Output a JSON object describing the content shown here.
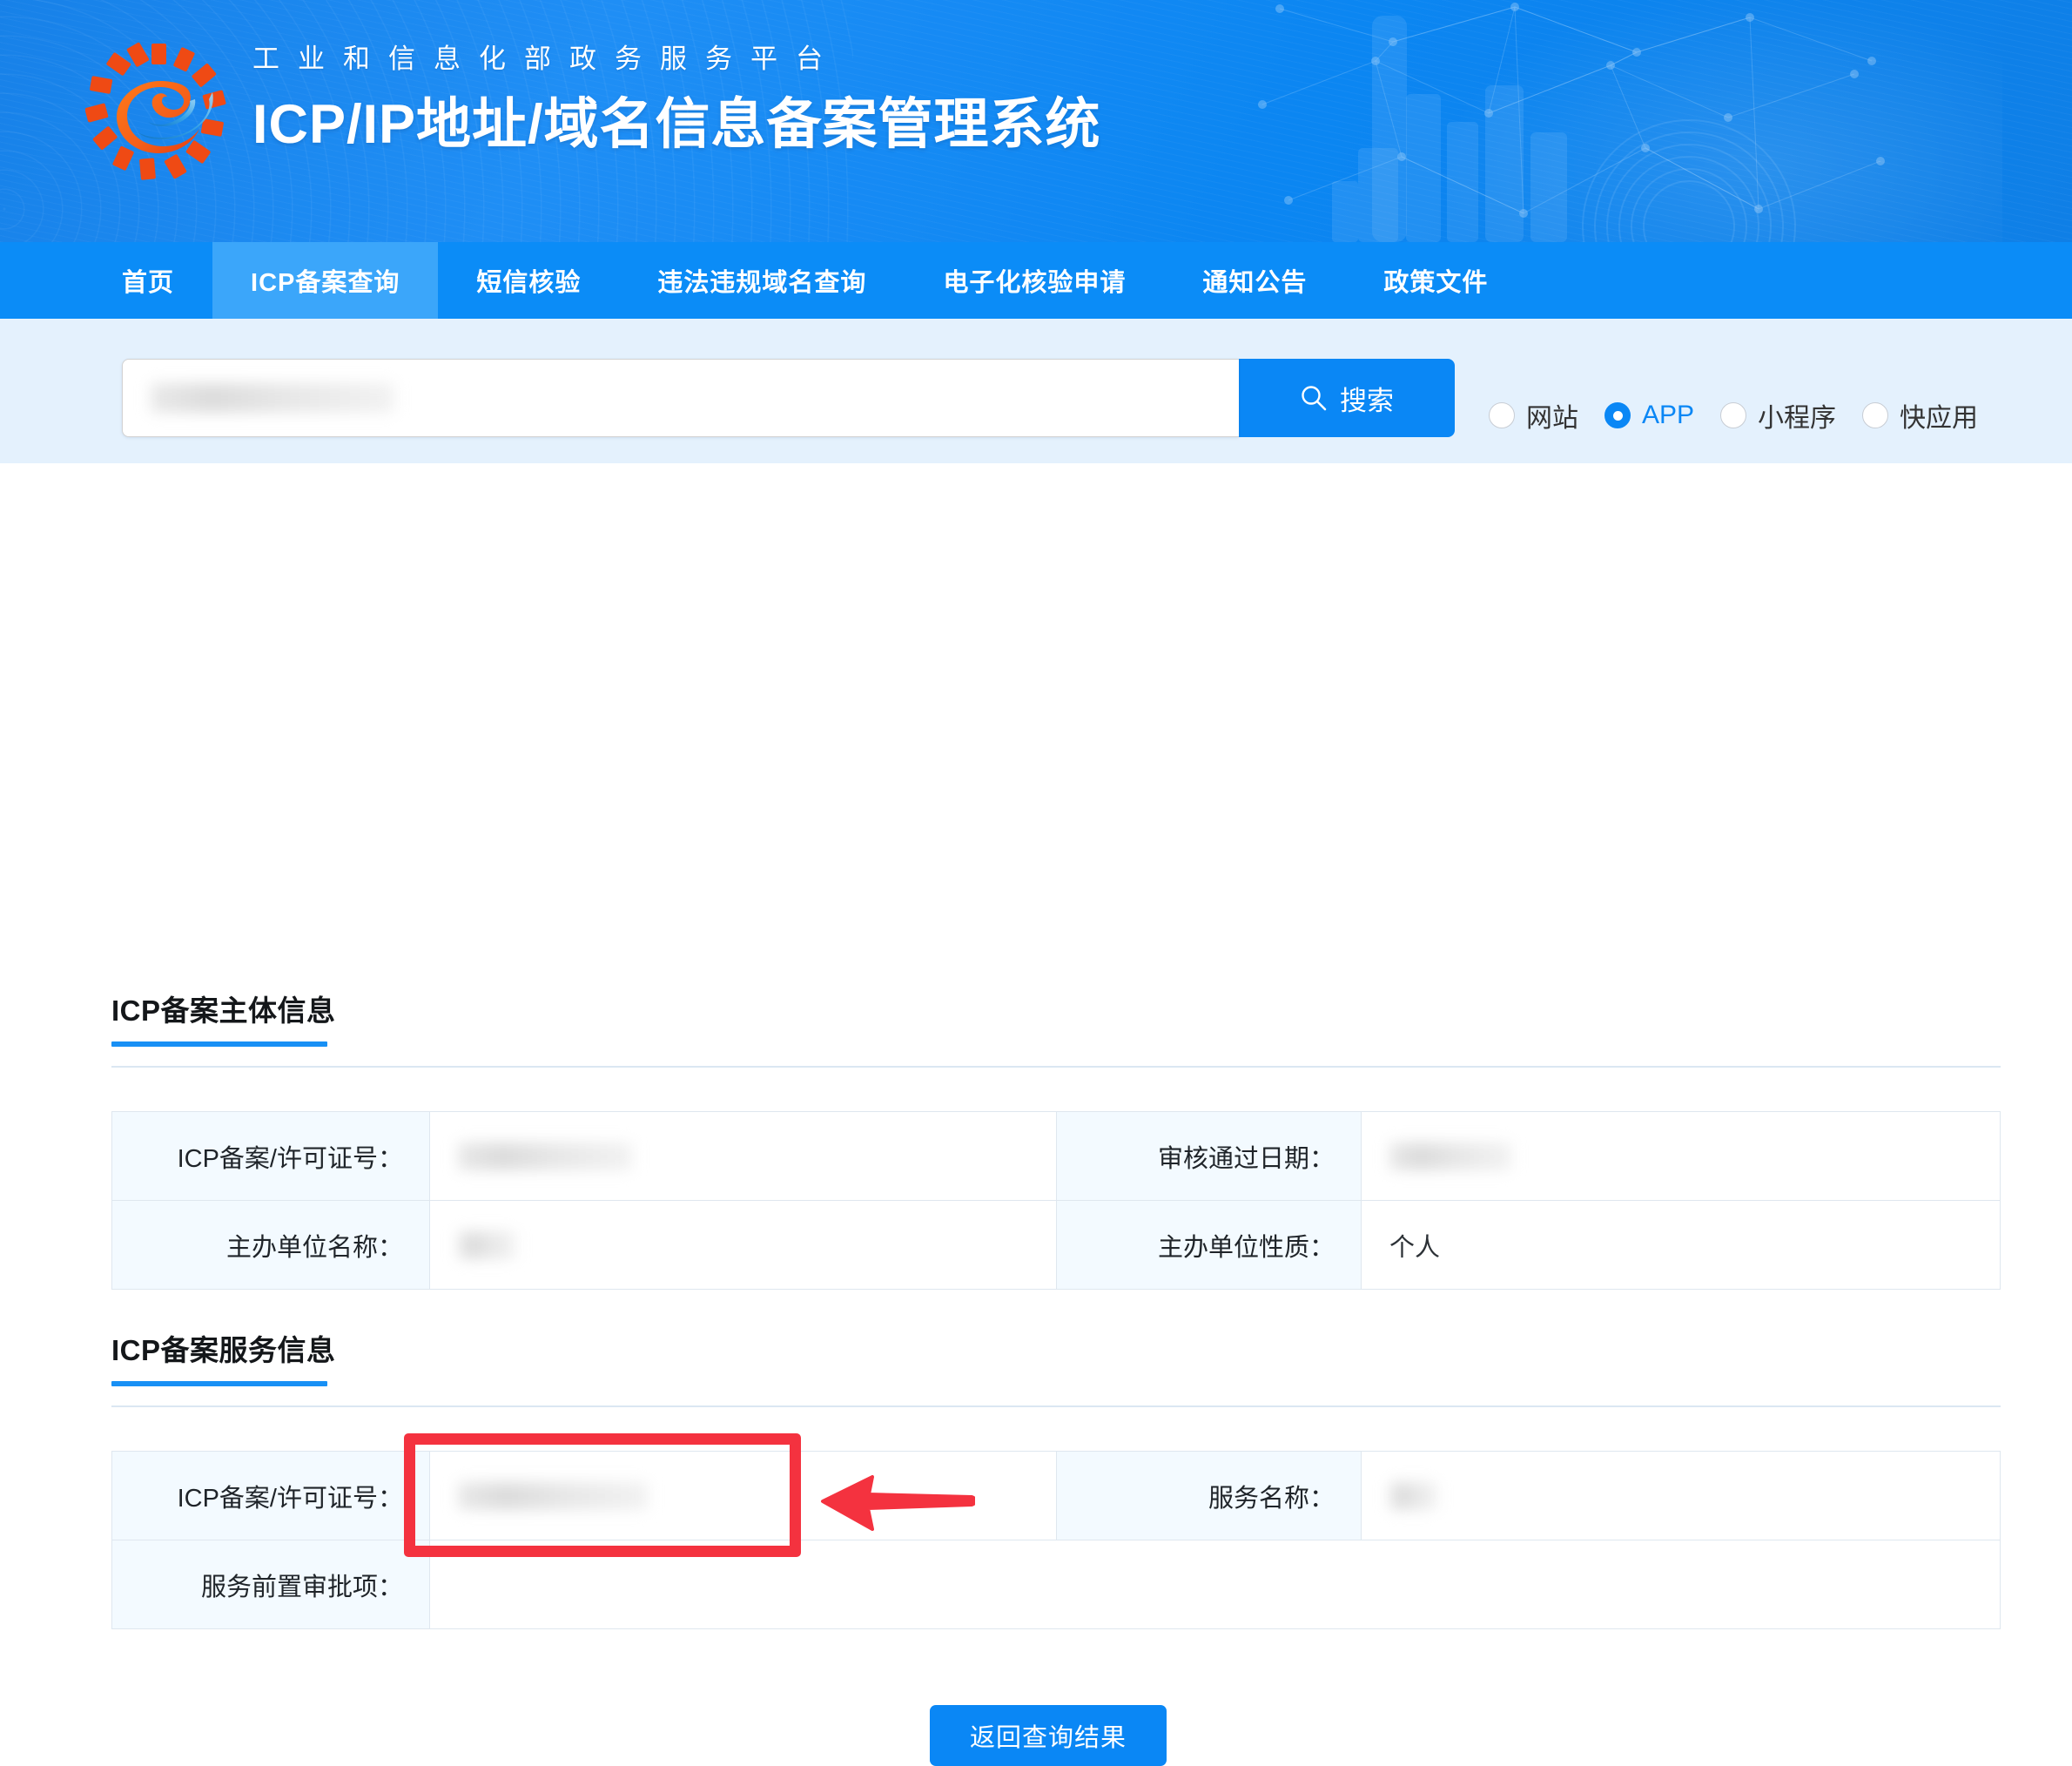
{
  "header": {
    "subtitle": "工业和信息化部政务服务平台",
    "title": "ICP/IP地址/域名信息备案管理系统",
    "logo_icon": "miit-gear-e-logo",
    "brand_color": "#0a87f5"
  },
  "nav": {
    "items": [
      {
        "label": "首页",
        "active": false
      },
      {
        "label": "ICP备案查询",
        "active": true
      },
      {
        "label": "短信核验",
        "active": false
      },
      {
        "label": "违法违规域名查询",
        "active": false
      },
      {
        "label": "电子化核验申请",
        "active": false
      },
      {
        "label": "通知公告",
        "active": false
      },
      {
        "label": "政策文件",
        "active": false
      }
    ],
    "active_bg": "#3ba6fa",
    "bg": "#0b8cf7"
  },
  "search": {
    "input_value": "",
    "input_redacted": true,
    "placeholder": "",
    "button_label": "搜索",
    "button_icon": "search-icon",
    "types": [
      {
        "label": "网站",
        "selected": false
      },
      {
        "label": "APP",
        "selected": true
      },
      {
        "label": "小程序",
        "selected": false
      },
      {
        "label": "快应用",
        "selected": false
      }
    ]
  },
  "sections": [
    {
      "title": "ICP备案主体信息",
      "rows": [
        {
          "left_label": "ICP备案/许可证号：",
          "left_value": "",
          "left_redacted": true,
          "left_redact_width": 200,
          "right_label": "审核通过日期：",
          "right_value": "",
          "right_redacted": true,
          "right_redact_width": 140
        },
        {
          "left_label": "主办单位名称：",
          "left_value": "",
          "left_redacted": true,
          "left_redact_width": 66,
          "right_label": "主办单位性质：",
          "right_value": "个人",
          "right_redacted": false,
          "right_redact_width": 0
        }
      ]
    },
    {
      "title": "ICP备案服务信息",
      "rows": [
        {
          "left_label": "ICP备案/许可证号：",
          "left_value": "",
          "left_redacted": true,
          "left_redact_width": 218,
          "right_label": "服务名称：",
          "right_value": "",
          "right_redacted": true,
          "right_redact_width": 54
        },
        {
          "left_label": "服务前置审批项：",
          "left_value": "",
          "left_redacted": false,
          "left_redact_width": 0,
          "right_label": "",
          "right_value": "",
          "right_redacted": false,
          "right_redact_width": 0,
          "full_width_value": true
        }
      ]
    }
  ],
  "annotation": {
    "box_color": "#f4323f",
    "arrow_color": "#f4323f",
    "box_label": "highlight-icp-license-number",
    "arrow_direction": "left"
  },
  "footer": {
    "back_button_label": "返回查询结果"
  }
}
